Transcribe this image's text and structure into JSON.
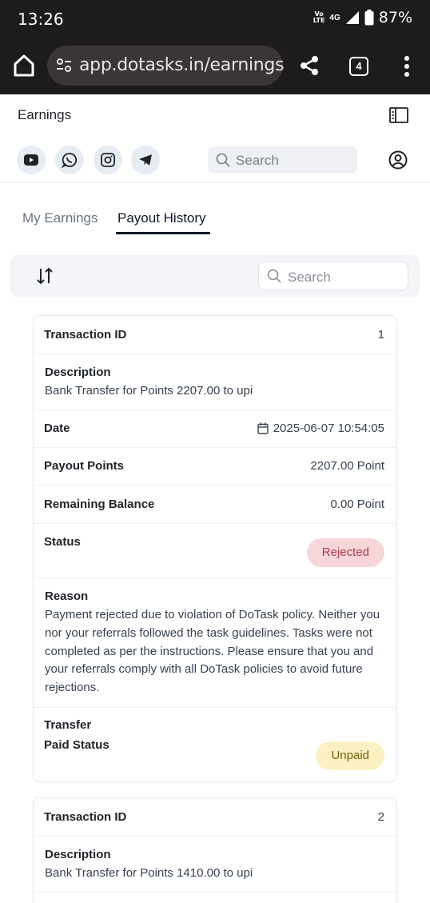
{
  "status_bar": {
    "time": "13:26",
    "volte_line1": "Vo",
    "volte_line2": "LTE",
    "network": "4G",
    "battery": "87%"
  },
  "browser": {
    "url": "app.dotasks.in/earnings",
    "tab_count": "4"
  },
  "header": {
    "title": "Earnings",
    "search_placeholder": "Search",
    "social_icons": [
      "youtube-icon",
      "whatsapp-icon",
      "instagram-icon",
      "telegram-icon"
    ]
  },
  "tabs": [
    {
      "label": "My Earnings",
      "active": false
    },
    {
      "label": "Payout History",
      "active": true
    }
  ],
  "toolbar": {
    "search_placeholder": "Search"
  },
  "cards": [
    {
      "transaction_id_label": "Transaction ID",
      "transaction_id": "1",
      "description_label": "Description",
      "description": "Bank Transfer for Points 2207.00 to upi",
      "date_label": "Date",
      "date": "2025-06-07 10:54:05",
      "payout_points_label": "Payout Points",
      "payout_points": "2207.00 Point",
      "remaining_balance_label": "Remaining Balance",
      "remaining_balance": "0.00 Point",
      "status_label": "Status",
      "status": "Rejected",
      "reason_label": "Reason",
      "reason": "Payment rejected due to violation of DoTask policy. Neither you nor your referrals followed the task guidelines. Tasks were not completed as per the instructions. Please ensure that you and your referrals comply with all DoTask policies to avoid future rejections.",
      "transfer_label": "Transfer",
      "paid_status_label": "Paid Status",
      "paid_status": "Unpaid"
    },
    {
      "transaction_id_label": "Transaction ID",
      "transaction_id": "2",
      "description_label": "Description",
      "description": "Bank Transfer for Points 1410.00 to upi"
    }
  ],
  "colors": {
    "status_rejected_bg": "#f7d6da",
    "status_rejected_text": "#b03a48",
    "unpaid_bg": "#fbf1c4",
    "unpaid_text": "#7a5d0b",
    "browser_chrome": "#1d1b1b"
  }
}
